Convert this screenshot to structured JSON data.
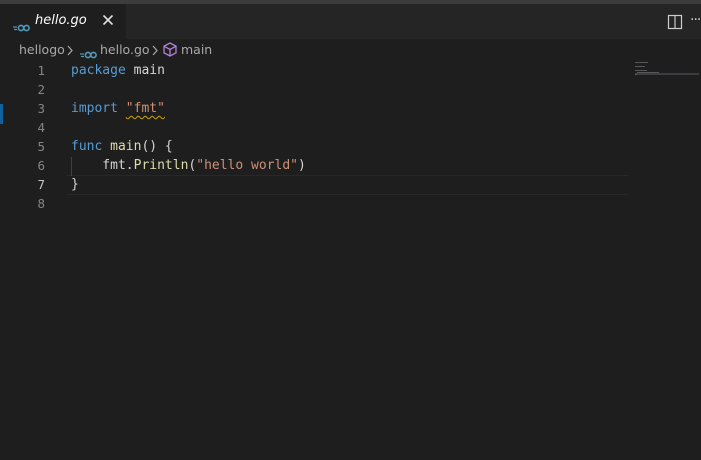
{
  "tab": {
    "filename": "hello.go",
    "icon": "go-file-icon",
    "close_glyph": "✕"
  },
  "toolbar": {
    "more_glyph": "···"
  },
  "breadcrumb": {
    "folder": "hellogo",
    "file": "hello.go",
    "symbol": "main"
  },
  "colors": {
    "editor_bg": "#1e1e1e",
    "tabbar_bg": "#252526",
    "keyword": "#569cd6",
    "function": "#dcdcaa",
    "string": "#ce9178",
    "go_icon": "#519aba",
    "symbol_icon": "#b180d7"
  },
  "editor": {
    "active_line": "7",
    "lines": [
      {
        "num": "1",
        "tokens": [
          {
            "t": "package",
            "c": "kw"
          },
          {
            "t": " main",
            "c": "ident"
          }
        ]
      },
      {
        "num": "2",
        "tokens": []
      },
      {
        "num": "3",
        "tokens": [
          {
            "t": "import",
            "c": "kw"
          },
          {
            "t": " ",
            "c": "ident"
          },
          {
            "t": "\"fmt\"",
            "c": "str squiggle"
          }
        ]
      },
      {
        "num": "4",
        "tokens": []
      },
      {
        "num": "5",
        "tokens": [
          {
            "t": "func",
            "c": "kw"
          },
          {
            "t": " ",
            "c": "ident"
          },
          {
            "t": "main",
            "c": "fn"
          },
          {
            "t": "() {",
            "c": "ident"
          }
        ]
      },
      {
        "num": "6",
        "tokens": [
          {
            "t": "    fmt.",
            "c": "ident"
          },
          {
            "t": "Println",
            "c": "fn"
          },
          {
            "t": "(",
            "c": "ident"
          },
          {
            "t": "\"hello world\"",
            "c": "str"
          },
          {
            "t": ")",
            "c": "ident"
          }
        ]
      },
      {
        "num": "7",
        "tokens": [
          {
            "t": "}",
            "c": "ident"
          }
        ]
      },
      {
        "num": "8",
        "tokens": []
      }
    ]
  }
}
